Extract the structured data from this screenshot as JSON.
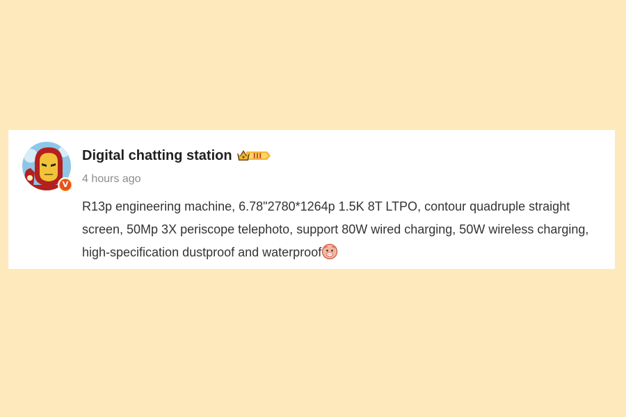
{
  "post": {
    "author": {
      "name": "Digital chatting station",
      "verified_mark": "V",
      "rank_badge_text": "III",
      "avatar_icon": "iron-man-avatar-icon",
      "rank_icon": "crown-rank-badge-icon"
    },
    "timestamp": "4 hours ago",
    "content": "R13p engineering machine, 6.78\"2780*1264p 1.5K 8T LTPO, contour quadruple straight screen, 50Mp 3X periscope telephoto, support 80W wired charging, 50W wireless charging, high-specification dustproof and waterproof",
    "trailing_emoji": "doge-emoji-icon"
  },
  "colors": {
    "background": "#fde9bb",
    "card": "#ffffff",
    "author_text": "#1f1f1f",
    "timestamp_text": "#8c8c8c",
    "body_text": "#333333",
    "verified_badge": "#e8501e"
  }
}
